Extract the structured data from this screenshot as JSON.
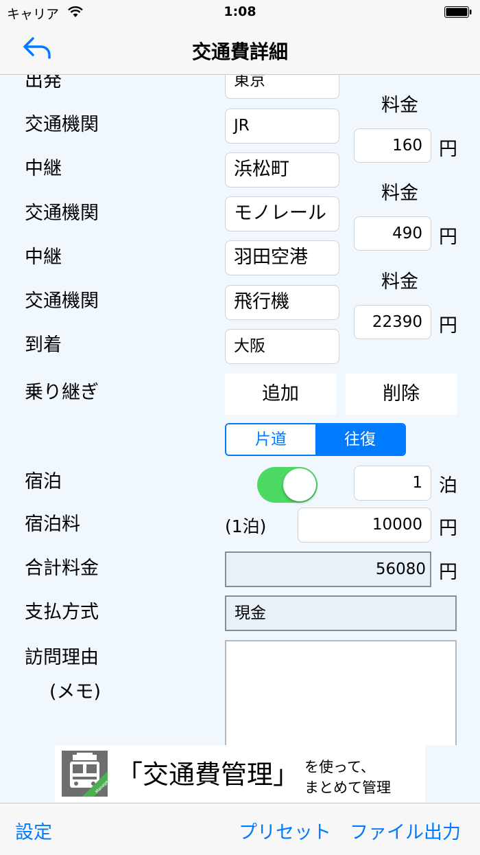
{
  "status": {
    "carrier": "キャリア",
    "time": "1:08"
  },
  "nav": {
    "title": "交通費詳細"
  },
  "labels": {
    "departure": "出発",
    "transport1": "交通機関",
    "transfer1": "中継",
    "transport2": "交通機関",
    "transfer2": "中継",
    "transport3": "交通機関",
    "arrival": "到着",
    "connection": "乗り継ぎ",
    "lodging": "宿泊",
    "lodging_fee": "宿泊料",
    "total": "合計料金",
    "payment": "支払方式",
    "reason_line1": "訪問理由",
    "reason_line2": "(メモ)"
  },
  "route": {
    "departure": "東京",
    "transport1": "JR",
    "transfer1": "浜松町",
    "transport2": "モノレール",
    "transfer2": "羽田空港",
    "transport3": "飛行機",
    "arrival": "大阪"
  },
  "fees": {
    "label": "料金",
    "unit": "円",
    "fee1": "160",
    "fee2": "490",
    "fee3": "22390"
  },
  "buttons": {
    "add": "追加",
    "delete": "削除"
  },
  "trip_type": {
    "one_way": "片道",
    "round_trip": "往復",
    "selected": "往復"
  },
  "lodging": {
    "enabled": true,
    "nights": "1",
    "nights_unit": "泊",
    "per_night_label": "(1泊)",
    "fee": "10000"
  },
  "total": {
    "value": "56080"
  },
  "payment": {
    "value": "現金"
  },
  "memo": {
    "value": ""
  },
  "ad": {
    "main": "「交通費管理」",
    "line1": "を使って、",
    "line2": "まとめて管理",
    "icon_text": "Manage"
  },
  "toolbar": {
    "settings": "設定",
    "preset": "プリセット",
    "file_export": "ファイル出力"
  },
  "colors": {
    "accent": "#007aff",
    "toggle_on": "#4cd964",
    "background": "#f0f8fe"
  }
}
